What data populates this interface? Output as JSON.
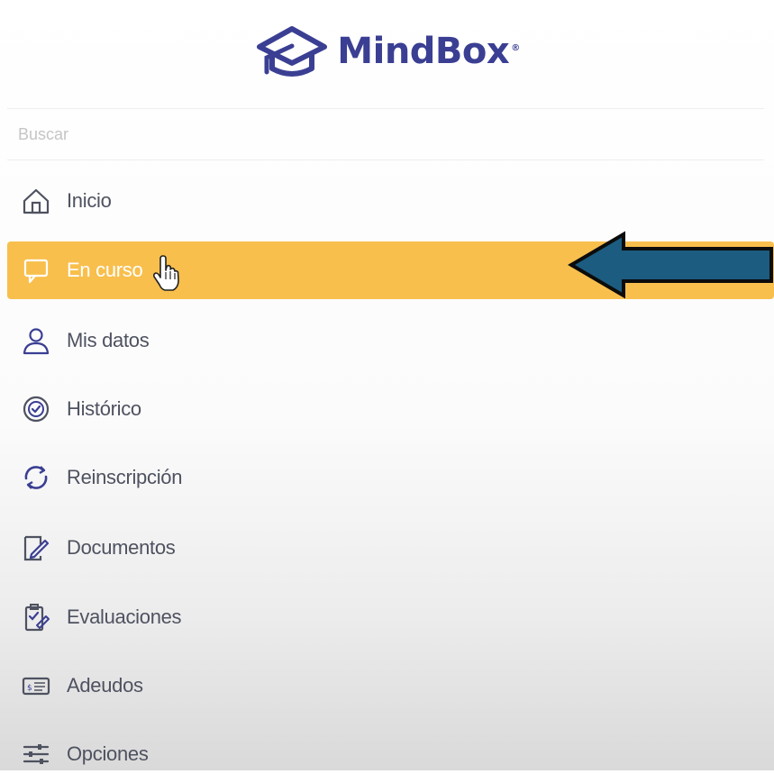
{
  "app": {
    "logo_text": "MindBox",
    "logo_mark": "®",
    "brand_color": "#3b3f93"
  },
  "search": {
    "placeholder": "Buscar",
    "value": ""
  },
  "sidebar": {
    "active_color": "#f8bf4d",
    "items": [
      {
        "label": "Inicio",
        "icon": "home-icon",
        "active": false
      },
      {
        "label": "En curso",
        "icon": "monitor-chat-icon",
        "active": true
      },
      {
        "label": "Mis datos",
        "icon": "user-icon",
        "active": false
      },
      {
        "label": "Histórico",
        "icon": "history-badge-icon",
        "active": false
      },
      {
        "label": "Reinscripción",
        "icon": "refresh-icon",
        "active": false
      },
      {
        "label": "Documentos",
        "icon": "document-edit-icon",
        "active": false
      },
      {
        "label": "Evaluaciones",
        "icon": "clipboard-check-icon",
        "active": false
      },
      {
        "label": "Adeudos",
        "icon": "payment-card-icon",
        "active": false
      },
      {
        "label": "Opciones",
        "icon": "sliders-icon",
        "active": false
      }
    ]
  },
  "annotation": {
    "arrow_color": "#1c5c80",
    "arrow_icon": "left-arrow-annotation"
  }
}
